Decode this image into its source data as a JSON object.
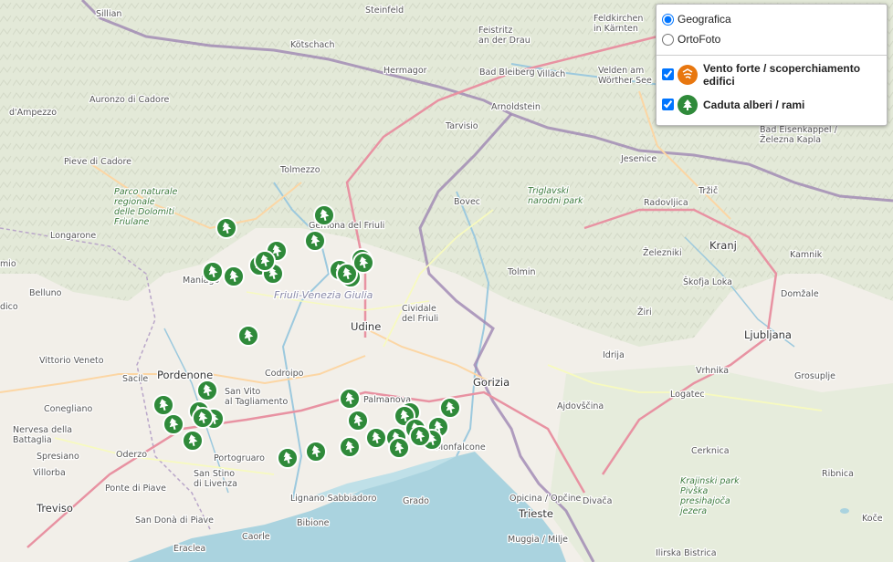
{
  "places": [
    {
      "name": "Sillian",
      "kind": "town"
    },
    {
      "name": "Steinfeld",
      "kind": "town"
    },
    {
      "name": "Kötschach",
      "kind": "town"
    },
    {
      "name": "Feistritz an der Drau",
      "kind": "town"
    },
    {
      "name": "Feldkirchen in Kärnten",
      "kind": "town"
    },
    {
      "name": "Hermagor",
      "kind": "town"
    },
    {
      "name": "Bad Bleiberg",
      "kind": "town"
    },
    {
      "name": "Villach",
      "kind": "town"
    },
    {
      "name": "Velden am Wörther See",
      "kind": "town"
    },
    {
      "name": "Auronzo di Cadore",
      "kind": "town"
    },
    {
      "name": "d'Ampezzo",
      "kind": "town"
    },
    {
      "name": "Arnoldstein",
      "kind": "town"
    },
    {
      "name": "Tarvisio",
      "kind": "town"
    },
    {
      "name": "Bad Eisenkappel / Železna Kapla",
      "kind": "town"
    },
    {
      "name": "Pieve di Cadore",
      "kind": "town"
    },
    {
      "name": "Tolmezzo",
      "kind": "town"
    },
    {
      "name": "Jesenice",
      "kind": "town"
    },
    {
      "name": "Tržič",
      "kind": "town"
    },
    {
      "name": "Parco naturale regionale delle Dolomiti Friulane",
      "kind": "park"
    },
    {
      "name": "Triglavski narodni park",
      "kind": "park"
    },
    {
      "name": "Bovec",
      "kind": "town"
    },
    {
      "name": "Radovljica",
      "kind": "town"
    },
    {
      "name": "Gemona del Friuli",
      "kind": "town"
    },
    {
      "name": "Longarone",
      "kind": "town"
    },
    {
      "name": "Kranj",
      "kind": "city"
    },
    {
      "name": "Kamnik",
      "kind": "town"
    },
    {
      "name": "Železniki",
      "kind": "town"
    },
    {
      "name": "Tolmin",
      "kind": "town"
    },
    {
      "name": "Maniago",
      "kind": "town"
    },
    {
      "name": "Škofja Loka",
      "kind": "town"
    },
    {
      "name": "Domžale",
      "kind": "town"
    },
    {
      "name": "Belluno",
      "kind": "town"
    },
    {
      "name": "Friuli-Venezia Giulia",
      "kind": "region"
    },
    {
      "name": "Cividale del Friuli",
      "kind": "town"
    },
    {
      "name": "Udine",
      "kind": "city"
    },
    {
      "name": "Žiri",
      "kind": "town"
    },
    {
      "name": "Ljubljana",
      "kind": "city"
    },
    {
      "name": "Vittorio Veneto",
      "kind": "town"
    },
    {
      "name": "Idrija",
      "kind": "town"
    },
    {
      "name": "Pordenone",
      "kind": "city"
    },
    {
      "name": "Sacile",
      "kind": "town"
    },
    {
      "name": "San Vito al Tagliamento",
      "kind": "town"
    },
    {
      "name": "Codroipo",
      "kind": "town"
    },
    {
      "name": "Vrhnika",
      "kind": "town"
    },
    {
      "name": "Grosuplje",
      "kind": "town"
    },
    {
      "name": "Gorizia",
      "kind": "city"
    },
    {
      "name": "Conegliano",
      "kind": "town"
    },
    {
      "name": "Palmanova",
      "kind": "town"
    },
    {
      "name": "Ajdovščina",
      "kind": "town"
    },
    {
      "name": "Logatec",
      "kind": "town"
    },
    {
      "name": "Nervesa della Battaglia",
      "kind": "town"
    },
    {
      "name": "Spresiano",
      "kind": "town"
    },
    {
      "name": "Oderzo",
      "kind": "town"
    },
    {
      "name": "Portogruaro",
      "kind": "town"
    },
    {
      "name": "Monfalcone",
      "kind": "town"
    },
    {
      "name": "Cerknica",
      "kind": "town"
    },
    {
      "name": "Villorba",
      "kind": "town"
    },
    {
      "name": "San Stino di Livenza",
      "kind": "town"
    },
    {
      "name": "Krajinski park Pivška presihajoča jezera",
      "kind": "park"
    },
    {
      "name": "Ponte di Piave",
      "kind": "town"
    },
    {
      "name": "Ribnica",
      "kind": "town"
    },
    {
      "name": "Lignano Sabbiadoro",
      "kind": "town"
    },
    {
      "name": "Grado",
      "kind": "town"
    },
    {
      "name": "Opicina / Opčine",
      "kind": "town"
    },
    {
      "name": "Divača",
      "kind": "town"
    },
    {
      "name": "Treviso",
      "kind": "city"
    },
    {
      "name": "San Donà di Piave",
      "kind": "town"
    },
    {
      "name": "Bibione",
      "kind": "town"
    },
    {
      "name": "Trieste",
      "kind": "city"
    },
    {
      "name": "Caorle",
      "kind": "town"
    },
    {
      "name": "Eraclea",
      "kind": "town"
    },
    {
      "name": "Muggia / Milje",
      "kind": "town"
    },
    {
      "name": "Ilirska Bistrica",
      "kind": "town"
    },
    {
      "name": "dico",
      "kind": "town"
    },
    {
      "name": "mio",
      "kind": "town"
    },
    {
      "name": "Koče",
      "kind": "town"
    }
  ],
  "markers": [
    {
      "category": "caduta-alberi"
    },
    {
      "category": "caduta-alberi"
    },
    {
      "category": "caduta-alberi"
    },
    {
      "category": "caduta-alberi"
    },
    {
      "category": "caduta-alberi"
    },
    {
      "category": "caduta-alberi"
    },
    {
      "category": "caduta-alberi"
    },
    {
      "category": "caduta-alberi"
    },
    {
      "category": "caduta-alberi"
    },
    {
      "category": "caduta-alberi"
    },
    {
      "category": "caduta-alberi"
    },
    {
      "category": "caduta-alberi"
    },
    {
      "category": "caduta-alberi"
    },
    {
      "category": "caduta-alberi"
    },
    {
      "category": "caduta-alberi"
    },
    {
      "category": "caduta-alberi"
    },
    {
      "category": "caduta-alberi"
    },
    {
      "category": "caduta-alberi"
    },
    {
      "category": "caduta-alberi"
    },
    {
      "category": "caduta-alberi"
    },
    {
      "category": "caduta-alberi"
    },
    {
      "category": "caduta-alberi"
    },
    {
      "category": "caduta-alberi"
    },
    {
      "category": "caduta-alberi"
    },
    {
      "category": "caduta-alberi"
    },
    {
      "category": "caduta-alberi"
    },
    {
      "category": "caduta-alberi"
    },
    {
      "category": "caduta-alberi"
    },
    {
      "category": "caduta-alberi"
    },
    {
      "category": "caduta-alberi"
    },
    {
      "category": "caduta-alberi"
    },
    {
      "category": "caduta-alberi"
    },
    {
      "category": "caduta-alberi"
    },
    {
      "category": "caduta-alberi"
    },
    {
      "category": "caduta-alberi"
    },
    {
      "category": "caduta-alberi"
    },
    {
      "category": "caduta-alberi"
    }
  ],
  "layer_panel": {
    "base_layers": [
      {
        "label": "Geografica",
        "selected": true
      },
      {
        "label": "OrtoFoto",
        "selected": false
      }
    ],
    "overlays": [
      {
        "label": "Vento forte / scoperchiamento edifici",
        "checked": true,
        "color": "#e8770f",
        "icon": "wind-roof-icon"
      },
      {
        "label": "Caduta alberi / rami",
        "checked": true,
        "color": "#2f8a3a",
        "icon": "fallen-tree-icon"
      }
    ]
  },
  "colors": {
    "land": "#f2efe9",
    "mountains": "#dfe8d0",
    "sea": "#aad3df",
    "marker_green": "#2f8a3a",
    "marker_orange": "#e8770f",
    "border": "#9e86b3"
  }
}
